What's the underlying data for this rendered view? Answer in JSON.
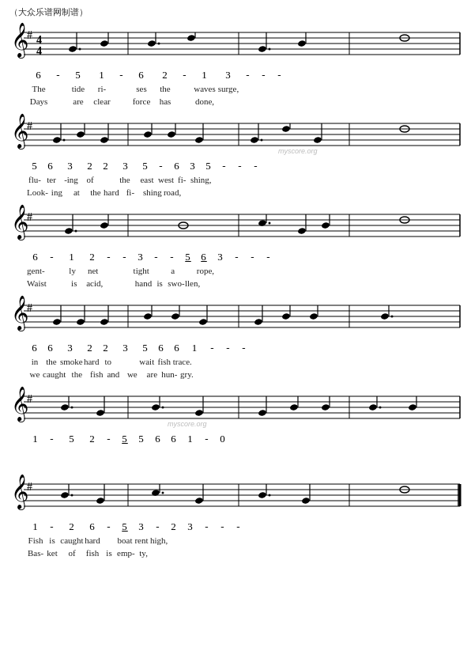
{
  "watermark": "（大众乐谱网制谱）",
  "myscore": "myscore.org",
  "sections": [
    {
      "id": 1,
      "numbers": "6  -  5    1  -  6    2  -  1    3  -  -  -",
      "lyric1": "The        tide      ri-        ses      the       waves    surge,",
      "lyric2": "Days       are       clear      force     has       done,"
    },
    {
      "id": 2,
      "numbers": "5  6  3    2  2  3    5  -6  3    5  -  -  -",
      "lyric1": "flu-  ter -ing   of    the    east   west  fi-   shing,",
      "lyric2": "Look- ing   at    the   hard   fi-    shing  road,",
      "watermark": true
    },
    {
      "id": 3,
      "numbers": "6  -  1    2  -  -  3  - - 5 6    3  -  -  -",
      "lyric1": "gent-   ly    net       tight    a      rope,",
      "lyric2": "Waist   is    acid,     hand    is swo-  llen,"
    },
    {
      "id": 4,
      "numbers": "6  6  3    2  2  3    5  6  6    1  -  -  -",
      "lyric1": "in    the smoke hard   to     wait   fish   trace.",
      "lyric2": "we   caught  the  fish  and   we    are   hun-  gry."
    },
    {
      "id": 5,
      "numbers": "1  -  5    2  -  5    5  6  6    1  -  0",
      "lyric1": "",
      "lyric2": "",
      "watermark": true
    },
    {
      "id": 6,
      "numbers": "1  -  2    6  -  5    3  -  2    3  -  -  -",
      "lyric1": "Fish   is   caught   hard   boat   rent   high,",
      "lyric2": "Bas-   ket  of       fish   is     emp-   ty,"
    }
  ]
}
